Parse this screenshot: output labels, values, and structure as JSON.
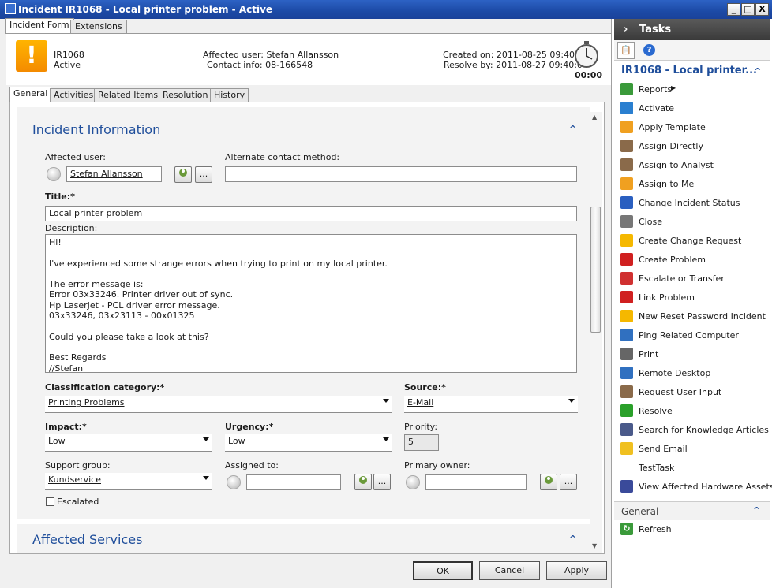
{
  "window": {
    "title": "Incident IR1068 - Local printer problem - Active",
    "min": "_",
    "max": "□",
    "close": "X"
  },
  "top_tabs": [
    "Incident Form",
    "Extensions"
  ],
  "header": {
    "id": "IR1068",
    "status": "Active",
    "affected_user": "Affected user: Stefan Allansson",
    "contact_info": "Contact info: 08-166548",
    "created_on": "Created on: 2011-08-25 09:40:04",
    "resolve_by": "Resolve by: 2011-08-27 09:40:04",
    "timer": "00:00"
  },
  "sub_tabs": [
    "General",
    "Activities",
    "Related Items",
    "Resolution",
    "History"
  ],
  "section1": {
    "title": "Incident Information"
  },
  "form": {
    "affected_user_label": "Affected user:",
    "affected_user_value": "Stefan Allansson",
    "alt_contact_label": "Alternate contact method:",
    "alt_contact_value": "",
    "title_label": "Title:*",
    "title_value": "Local printer problem",
    "description_label": "Description:",
    "description_lines": [
      "Hi!",
      "",
      "I've experienced some strange errors when trying to print on my local printer.",
      "",
      "The error message is:",
      "Error 03x33246. Printer driver out of sync.",
      "Hp LaserJet - PCL driver error message.",
      "03x33246, 03x23113 - 00x01325",
      "",
      "Could you please take a look at this?",
      "",
      "Best Regards",
      "//Stefan"
    ],
    "classification_label": "Classification category:*",
    "classification_value": "Printing Problems",
    "source_label": "Source:*",
    "source_value": "E-Mail",
    "impact_label": "Impact:*",
    "impact_value": "Low",
    "urgency_label": "Urgency:*",
    "urgency_value": "Low",
    "priority_label": "Priority:",
    "priority_value": "5",
    "support_group_label": "Support group:",
    "support_group_value": "Kundservice",
    "assigned_to_label": "Assigned to:",
    "assigned_to_value": "",
    "primary_owner_label": "Primary owner:",
    "primary_owner_value": "",
    "escalated_label": "Escalated",
    "browse": "..."
  },
  "section2": {
    "title": "Affected Services"
  },
  "buttons": {
    "ok": "OK",
    "cancel": "Cancel",
    "apply": "Apply"
  },
  "tasks": {
    "header": "Tasks",
    "group_title": "IR1068 - Local printer...",
    "items": [
      {
        "label": "Reports",
        "icon": "reports-icon",
        "color": "#3a9a3a"
      },
      {
        "label": "Activate",
        "icon": "activate-icon",
        "color": "#2a7fd0"
      },
      {
        "label": "Apply Template",
        "icon": "template-icon",
        "color": "#f0a020"
      },
      {
        "label": "Assign Directly",
        "icon": "assign-directly-icon",
        "color": "#8a6a4a"
      },
      {
        "label": "Assign to Analyst",
        "icon": "assign-analyst-icon",
        "color": "#8a6a4a"
      },
      {
        "label": "Assign to Me",
        "icon": "assign-me-icon",
        "color": "#f0a020"
      },
      {
        "label": "Change Incident Status",
        "icon": "status-icon",
        "color": "#2a5fc0"
      },
      {
        "label": "Close",
        "icon": "close-icon",
        "color": "#777777"
      },
      {
        "label": "Create Change Request",
        "icon": "change-request-icon",
        "color": "#f5b800"
      },
      {
        "label": "Create Problem",
        "icon": "problem-icon",
        "color": "#d02020"
      },
      {
        "label": "Escalate or Transfer",
        "icon": "escalate-icon",
        "color": "#d03030"
      },
      {
        "label": "Link Problem",
        "icon": "link-problem-icon",
        "color": "#d02020"
      },
      {
        "label": "New Reset Password Incident",
        "icon": "reset-password-icon",
        "color": "#f5b800"
      },
      {
        "label": "Ping Related Computer",
        "icon": "ping-icon",
        "color": "#3070c0"
      },
      {
        "label": "Print",
        "icon": "print-icon",
        "color": "#666666"
      },
      {
        "label": "Remote Desktop",
        "icon": "remote-desktop-icon",
        "color": "#3070c0"
      },
      {
        "label": "Request User Input",
        "icon": "request-input-icon",
        "color": "#8a6a4a"
      },
      {
        "label": "Resolve",
        "icon": "resolve-icon",
        "color": "#2aa02a"
      },
      {
        "label": "Search for Knowledge Articles",
        "icon": "search-knowledge-icon",
        "color": "#4a5a8a"
      },
      {
        "label": "Send Email",
        "icon": "email-icon",
        "color": "#f0c020"
      },
      {
        "label": "TestTask",
        "icon": "",
        "color": ""
      },
      {
        "label": "View Affected Hardware Assets",
        "icon": "hardware-icon",
        "color": "#3a4a9a"
      }
    ],
    "general_title": "General",
    "refresh": "Refresh"
  }
}
